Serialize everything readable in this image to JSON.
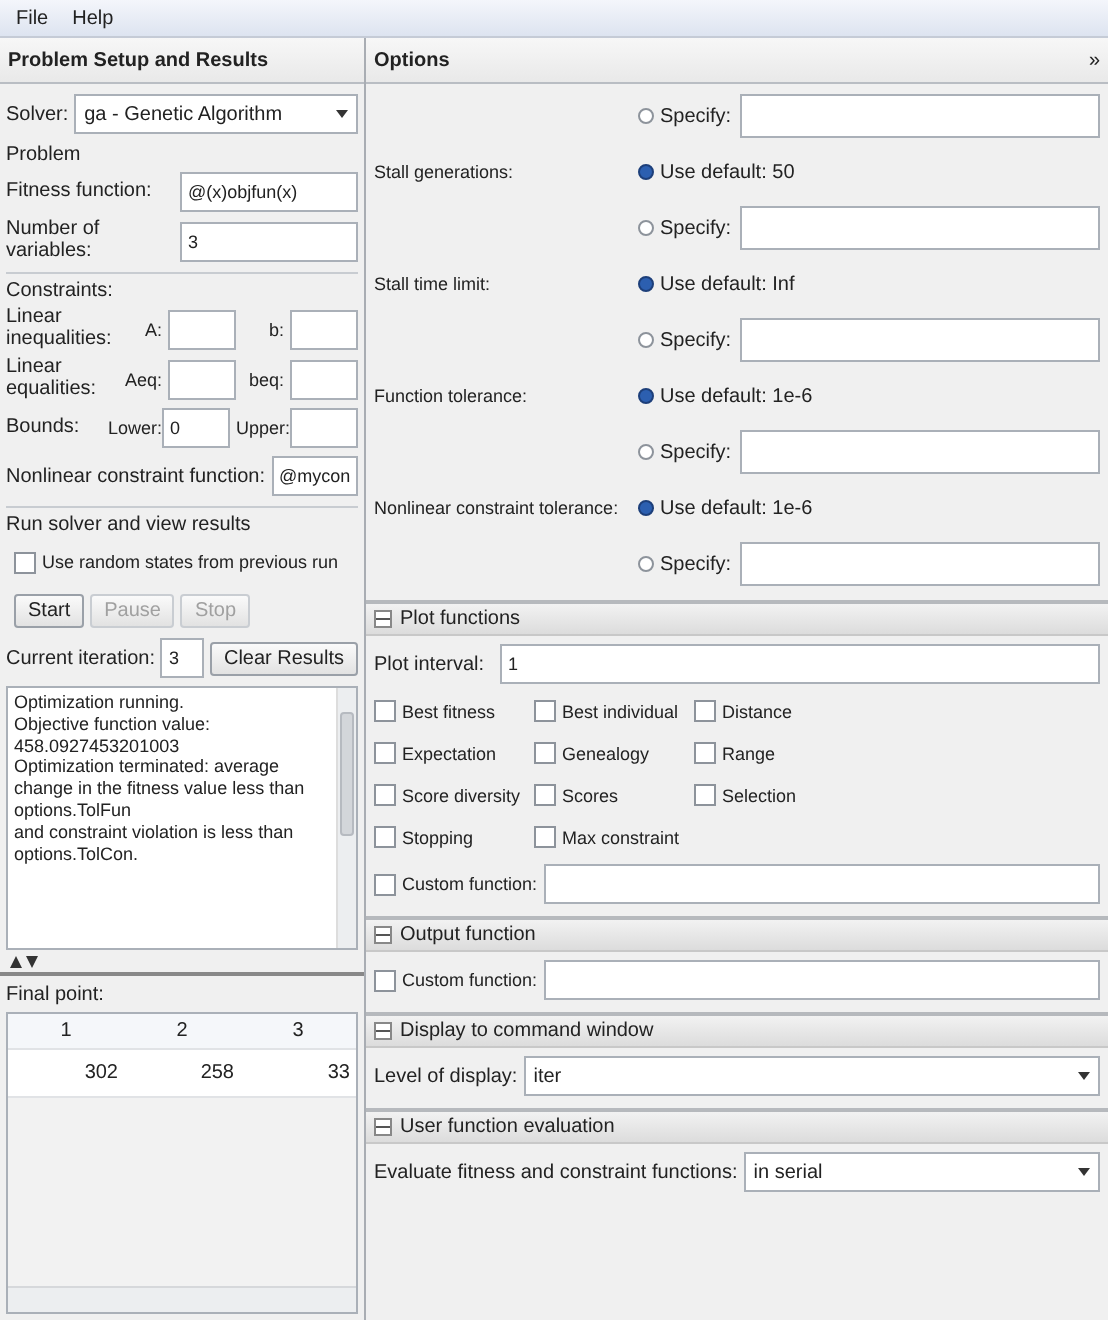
{
  "menu": [
    {
      "label": "File"
    },
    {
      "label": "Help"
    }
  ],
  "left": {
    "title": "Problem Setup and Results",
    "solver": {
      "label": "Solver:",
      "value": "ga - Genetic Algorithm"
    },
    "problem": {
      "title": "Problem",
      "fields": [
        {
          "label": "Fitness function:",
          "value": "@(x)objfun(x)"
        },
        {
          "label": "Number of variables:",
          "value": "3"
        }
      ]
    },
    "constraints": {
      "title": "Constraints:",
      "rows": [
        {
          "label": "Linear inequalities:",
          "a_label": "A:",
          "b_label": "b:"
        },
        {
          "label": "Linear equalities:",
          "a_label": "Aeq:",
          "b_label": "beq:"
        },
        {
          "label": "Bounds:",
          "a_label": "Lower:",
          "a_value": "0",
          "b_label": "Upper:"
        }
      ],
      "nonlinear": {
        "label": "Nonlinear constraint function:",
        "value": "@mycon"
      }
    },
    "run": {
      "title": "Run solver and view results",
      "checkbox": {
        "label": "Use random states from previous run",
        "checked": false
      },
      "buttons": [
        {
          "label": "Start",
          "disabled": false
        },
        {
          "label": "Pause",
          "disabled": true
        },
        {
          "label": "Stop",
          "disabled": true
        }
      ],
      "iteration_label": "Current iteration:",
      "iteration_value": "3",
      "clear_button": "Clear Results",
      "log": [
        "Optimization running.",
        "Objective function value: 458.0927453201003",
        "Optimization terminated: average change in the fitness value less than options.TolFun",
        "and constraint violation is less than options.TolCon."
      ]
    },
    "final_point": {
      "label": "Final point:",
      "columns": [
        "1",
        "2",
        "3"
      ],
      "values": [
        "302",
        "258",
        "33"
      ]
    }
  },
  "options": {
    "title": "Options",
    "toggle": "»",
    "stopping": [
      {
        "kind": "specify",
        "option": "Specify:",
        "selected": false
      },
      {
        "kind": "default",
        "label": "Stall generations:",
        "option": "Use default: 50",
        "selected": true
      },
      {
        "kind": "specify",
        "option": "Specify:",
        "selected": false
      },
      {
        "kind": "default",
        "label": "Stall time limit:",
        "option": "Use default: Inf",
        "selected": true
      },
      {
        "kind": "specify",
        "option": "Specify:",
        "selected": false
      },
      {
        "kind": "default",
        "label": "Function tolerance:",
        "option": "Use default: 1e-6",
        "selected": true
      },
      {
        "kind": "specify",
        "option": "Specify:",
        "selected": false
      },
      {
        "kind": "default",
        "label": "Nonlinear constraint tolerance:",
        "option": "Use default: 1e-6",
        "selected": true
      },
      {
        "kind": "specify",
        "option": "Specify:",
        "selected": false
      }
    ]
  },
  "plot": {
    "title": "Plot functions",
    "expanded": true,
    "interval_label": "Plot interval:",
    "interval_value": "1",
    "checks": [
      {
        "label": "Best fitness",
        "checked": false
      },
      {
        "label": "Best individual",
        "checked": false
      },
      {
        "label": "Distance",
        "checked": false
      },
      {
        "label": "Expectation",
        "checked": false
      },
      {
        "label": "Genealogy",
        "checked": false
      },
      {
        "label": "Range",
        "checked": false
      },
      {
        "label": "Score diversity",
        "checked": false
      },
      {
        "label": "Scores",
        "checked": false
      },
      {
        "label": "Selection",
        "checked": false
      },
      {
        "label": "Stopping",
        "checked": false
      },
      {
        "label": "Max constraint",
        "checked": false
      }
    ],
    "custom": {
      "label": "Custom function:",
      "checked": false
    }
  },
  "output": {
    "title": "Output function",
    "expanded": true,
    "custom": {
      "label": "Custom function:",
      "checked": false
    }
  },
  "display": {
    "title": "Display to command window",
    "expanded": true,
    "label": "Level of display:",
    "value": "iter"
  },
  "user_eval": {
    "title": "User function evaluation",
    "expanded": true,
    "label": "Evaluate fitness and constraint functions:",
    "value": "in serial"
  }
}
